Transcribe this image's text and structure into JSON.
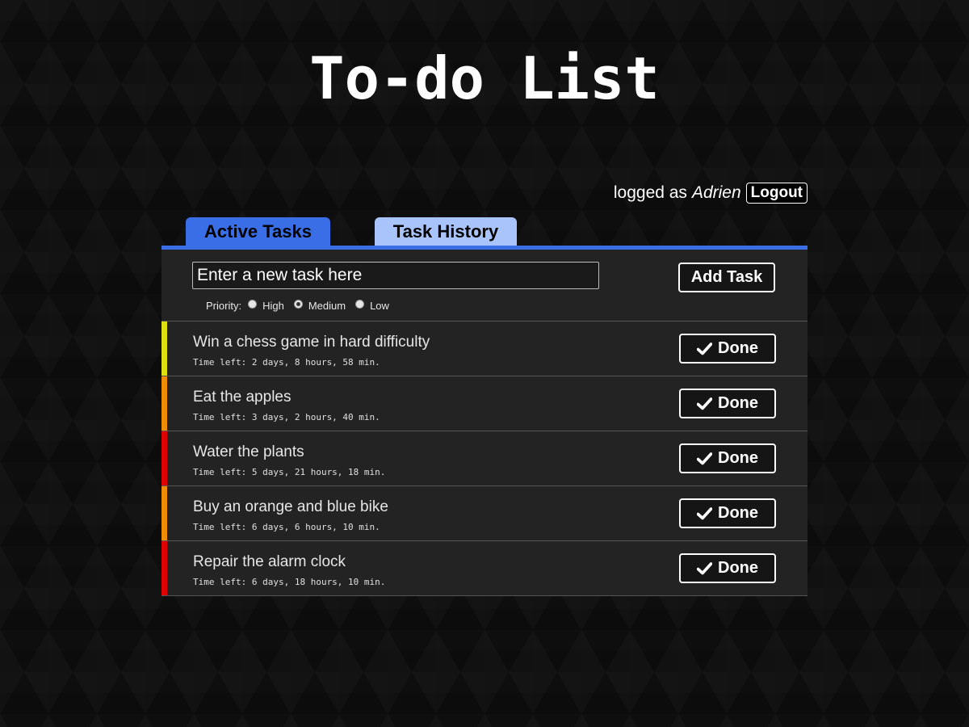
{
  "title": "To-do List",
  "user": {
    "prefix": "logged as",
    "name": "Adrien",
    "logout_label": "Logout"
  },
  "tabs": [
    {
      "label": "Active Tasks",
      "active": true
    },
    {
      "label": "Task History",
      "active": false
    }
  ],
  "new_task": {
    "placeholder": "Enter a new task here",
    "value": "",
    "add_label": "Add Task",
    "priority_label": "Priority:",
    "priority_options": [
      "High",
      "Medium",
      "Low"
    ],
    "priority_selected": "Medium"
  },
  "tasks": [
    {
      "name": "Win a chess game in hard difficulty",
      "time_left": "Time left: 2 days, 8 hours, 58 min.",
      "priority_color": "#e0e010",
      "done_label": "Done"
    },
    {
      "name": "Eat the apples",
      "time_left": "Time left: 3 days, 2 hours, 40 min.",
      "priority_color": "#f08c00",
      "done_label": "Done"
    },
    {
      "name": "Water the plants",
      "time_left": "Time left: 5 days, 21 hours, 18 min.",
      "priority_color": "#e00000",
      "done_label": "Done"
    },
    {
      "name": "Buy an orange and blue bike",
      "time_left": "Time left: 6 days, 6 hours, 10 min.",
      "priority_color": "#f08c00",
      "done_label": "Done"
    },
    {
      "name": "Repair the alarm clock",
      "time_left": "Time left: 6 days, 18 hours, 10 min.",
      "priority_color": "#e00000",
      "done_label": "Done"
    }
  ],
  "colors": {
    "accent": "#3a6ee6",
    "tab_inactive": "#a9c4fb",
    "panel_bg": "#232323"
  },
  "icons": {
    "done": "check-icon"
  }
}
